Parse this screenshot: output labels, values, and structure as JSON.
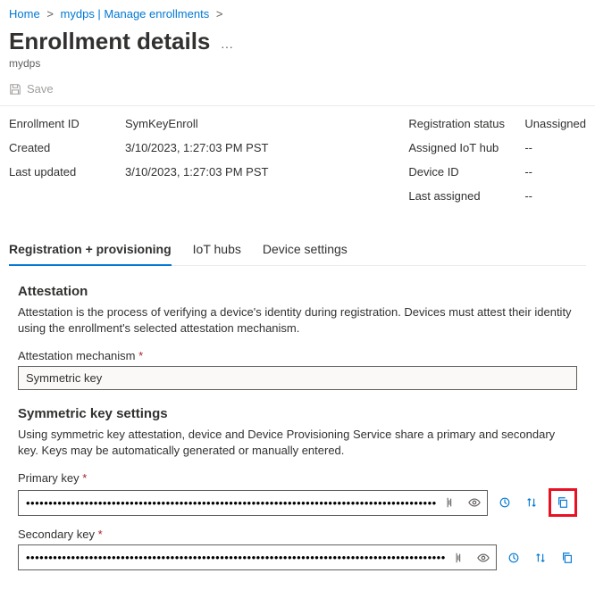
{
  "breadcrumb": {
    "home": "Home",
    "dps": "mydps | Manage enrollments"
  },
  "header": {
    "title": "Enrollment details",
    "subtitle": "mydps"
  },
  "toolbar": {
    "save_label": "Save"
  },
  "details": {
    "enrollment_id_label": "Enrollment ID",
    "enrollment_id_value": "SymKeyEnroll",
    "created_label": "Created",
    "created_value": "3/10/2023, 1:27:03 PM PST",
    "last_updated_label": "Last updated",
    "last_updated_value": "3/10/2023, 1:27:03 PM PST",
    "reg_status_label": "Registration status",
    "reg_status_value": "Unassigned",
    "assigned_hub_label": "Assigned IoT hub",
    "assigned_hub_value": "--",
    "device_id_label": "Device ID",
    "device_id_value": "--",
    "last_assigned_label": "Last assigned",
    "last_assigned_value": "--"
  },
  "tabs": {
    "reg": "Registration + provisioning",
    "hubs": "IoT hubs",
    "settings": "Device settings"
  },
  "attestation": {
    "title": "Attestation",
    "desc": "Attestation is the process of verifying a device's identity during registration. Devices must attest their identity using the enrollment's selected attestation mechanism.",
    "mechanism_label": "Attestation mechanism",
    "mechanism_value": "Symmetric key"
  },
  "symkey": {
    "title": "Symmetric key settings",
    "desc": "Using symmetric key attestation, device and Device Provisioning Service share a primary and secondary key. Keys may be automatically generated or manually entered.",
    "primary_label": "Primary key",
    "primary_value": "••••••••••••••••••••••••••••••••••••••••••••••••••••••••••••••••••••••••••••••••••••••••••••••••••••••••••••••",
    "secondary_label": "Secondary key",
    "secondary_value": "••••••••••••••••••••••••••••••••••••••••••••••••••••••••••••••••••••••••••••••••••••••••••••••••••••••••••••••"
  }
}
